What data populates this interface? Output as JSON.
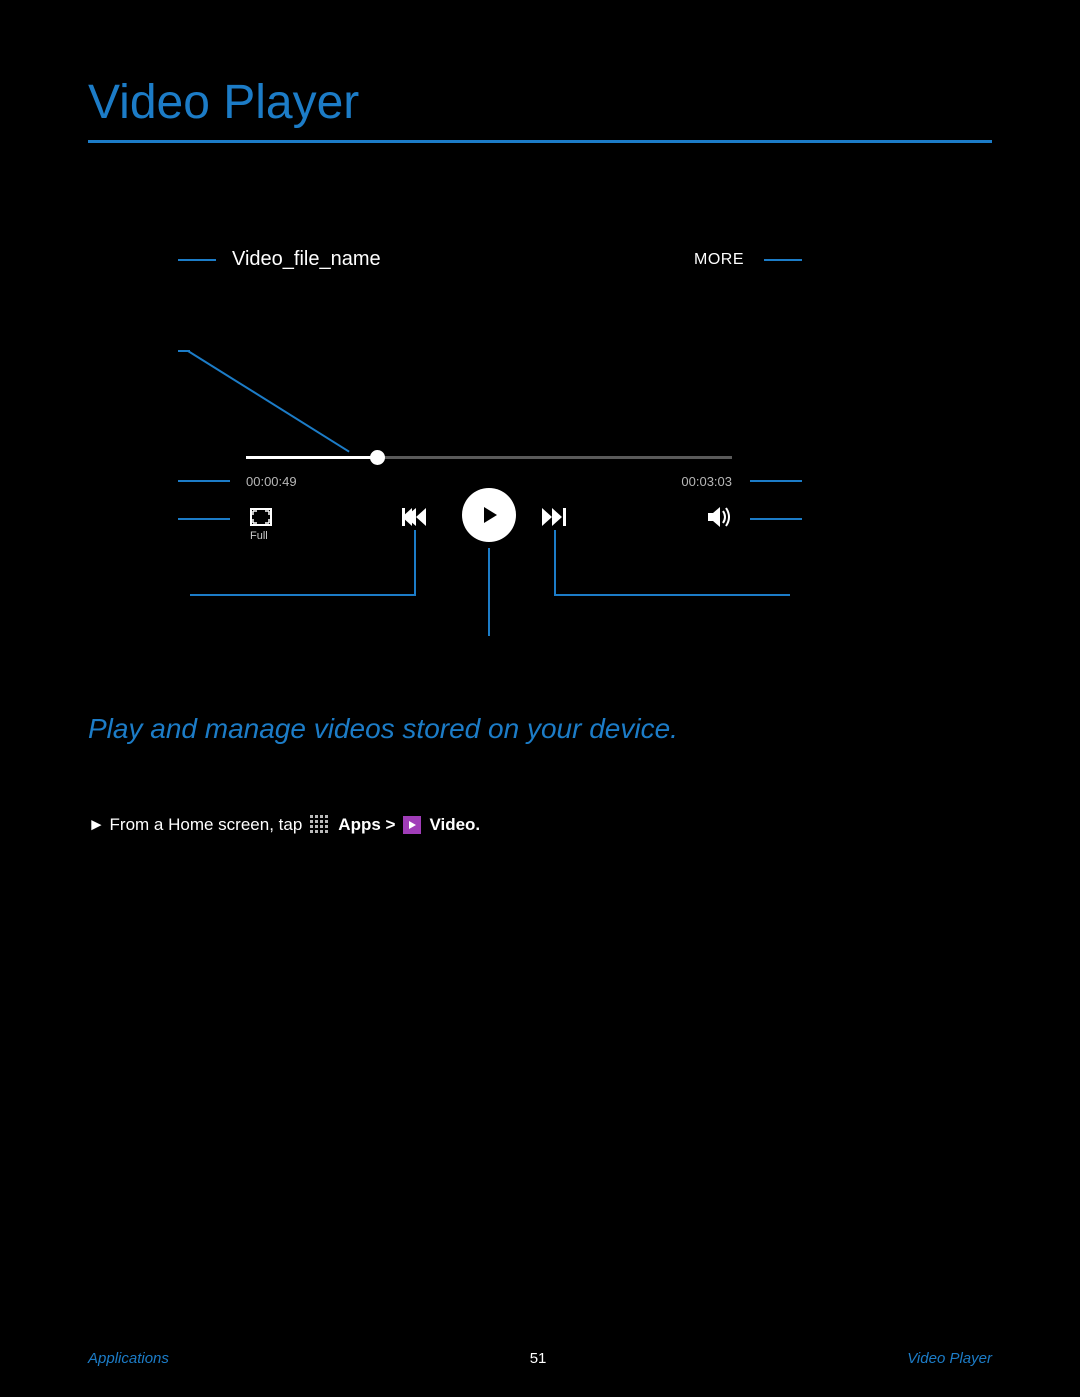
{
  "page": {
    "title": "Video Player",
    "subtitle": "Play and manage videos stored on your device."
  },
  "player": {
    "file_name": "Video_file_name",
    "more_label": "MORE",
    "time_current": "00:00:49",
    "time_total": "00:03:03",
    "full_label": "Full"
  },
  "instruction": {
    "prefix": "► From a Home screen, tap",
    "apps_label": "Apps >",
    "video_label": "Video."
  },
  "footer": {
    "left": "Applications",
    "page_number": "51",
    "right": "Video Player"
  }
}
